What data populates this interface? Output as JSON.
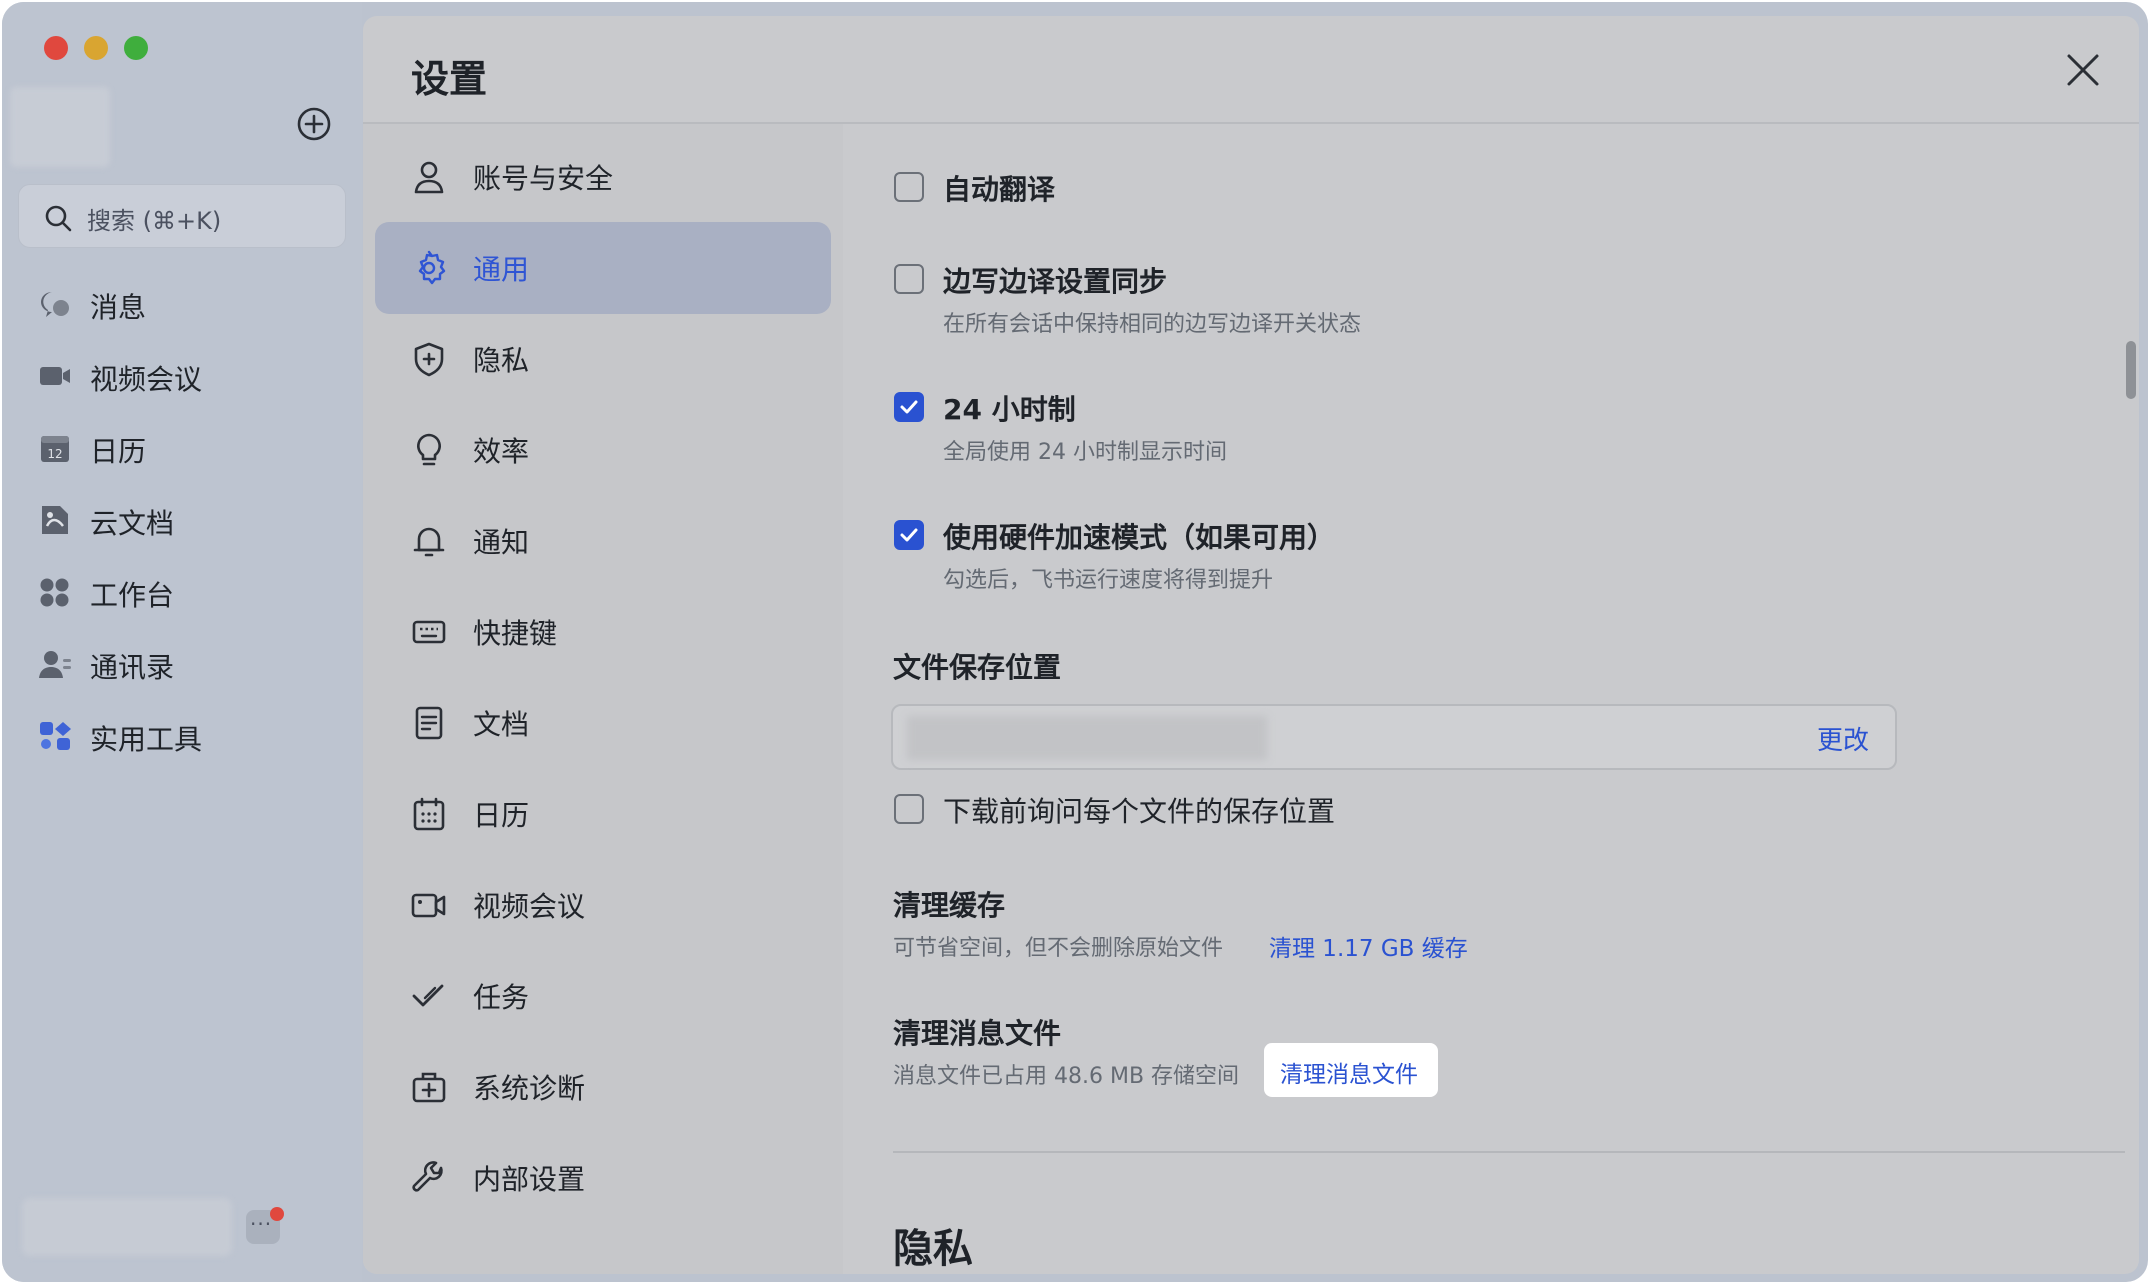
{
  "app": {
    "search_placeholder": "搜索 (⌘+K)",
    "nav": [
      {
        "label": "消息",
        "icon": "message-icon"
      },
      {
        "label": "视频会议",
        "icon": "video-icon"
      },
      {
        "label": "日历",
        "icon": "calendar-icon"
      },
      {
        "label": "云文档",
        "icon": "cloud-doc-icon"
      },
      {
        "label": "工作台",
        "icon": "workplace-icon"
      },
      {
        "label": "通讯录",
        "icon": "contacts-icon"
      },
      {
        "label": "实用工具",
        "icon": "tools-icon"
      }
    ],
    "more_label": "···"
  },
  "dialog": {
    "title": "设置",
    "nav": [
      {
        "label": "账号与安全",
        "icon": "user-icon",
        "active": false
      },
      {
        "label": "通用",
        "icon": "gear-icon",
        "active": true
      },
      {
        "label": "隐私",
        "icon": "shield-icon",
        "active": false
      },
      {
        "label": "效率",
        "icon": "bulb-icon",
        "active": false
      },
      {
        "label": "通知",
        "icon": "bell-icon",
        "active": false
      },
      {
        "label": "快捷键",
        "icon": "keyboard-icon",
        "active": false
      },
      {
        "label": "文档",
        "icon": "document-icon",
        "active": false
      },
      {
        "label": "日历",
        "icon": "calendar-icon",
        "active": false
      },
      {
        "label": "视频会议",
        "icon": "video-icon",
        "active": false
      },
      {
        "label": "任务",
        "icon": "task-icon",
        "active": false
      },
      {
        "label": "系统诊断",
        "icon": "diagnose-icon",
        "active": false
      },
      {
        "label": "内部设置",
        "icon": "wrench-icon",
        "active": false
      }
    ],
    "options": {
      "auto_translate": {
        "title": "自动翻译",
        "checked": false
      },
      "sync_translate": {
        "title": "边写边译设置同步",
        "desc": "在所有会话中保持相同的边写边译开关状态",
        "checked": false
      },
      "clock24": {
        "title": "24 小时制",
        "desc": "全局使用 24 小时制显示时间",
        "checked": true
      },
      "hw_accel": {
        "title": "使用硬件加速模式（如果可用）",
        "desc": "勾选后，飞书运行速度将得到提升",
        "checked": true
      }
    },
    "file_save": {
      "title": "文件保存位置",
      "change_label": "更改",
      "ask_label": "下载前询问每个文件的保存位置",
      "ask_checked": false
    },
    "clear_cache": {
      "title": "清理缓存",
      "desc": "可节省空间，但不会删除原始文件",
      "link": "清理 1.17 GB 缓存"
    },
    "clear_msg_files": {
      "title": "清理消息文件",
      "desc": "消息文件已占用 48.6 MB 存储空间",
      "link": "清理消息文件"
    },
    "next_section": "隐私"
  },
  "colors": {
    "accent": "#2a52d1",
    "active_nav_bg": "#a9b0c3",
    "traffic_red": "#e0483e",
    "traffic_yellow": "#d9a531",
    "traffic_green": "#3fae3d"
  }
}
